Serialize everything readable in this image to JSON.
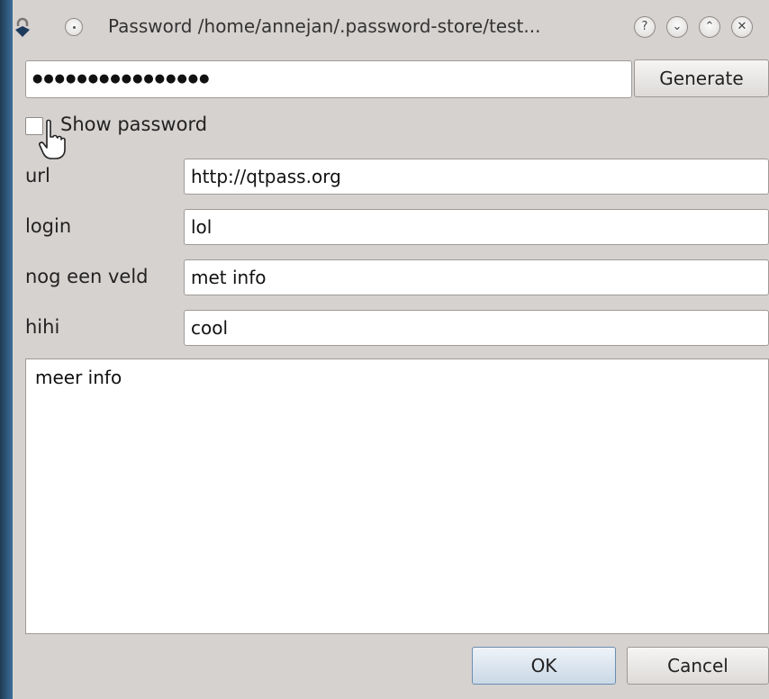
{
  "window": {
    "title": "Password /home/annejan/.password-store/test...",
    "buttons": {
      "help": "?",
      "minimize": "⌄",
      "maximize": "⌃",
      "close": "✕"
    }
  },
  "password": {
    "masked_value": "●●●●●●●●●●●●●●●●",
    "generate_label": "Generate"
  },
  "show_password": {
    "label": "Show password",
    "checked": false
  },
  "fields": [
    {
      "label": "url",
      "value": "http://qtpass.org"
    },
    {
      "label": "login",
      "value": "lol"
    },
    {
      "label": "nog een veld",
      "value": "met info"
    },
    {
      "label": "hihi",
      "value": "cool"
    }
  ],
  "notes": {
    "text": "meer info"
  },
  "dialog_buttons": {
    "ok": "OK",
    "cancel": "Cancel"
  },
  "colors": {
    "frame": "#2f5b80",
    "background": "#d6d2d0",
    "default_button": "#cad8e6"
  }
}
